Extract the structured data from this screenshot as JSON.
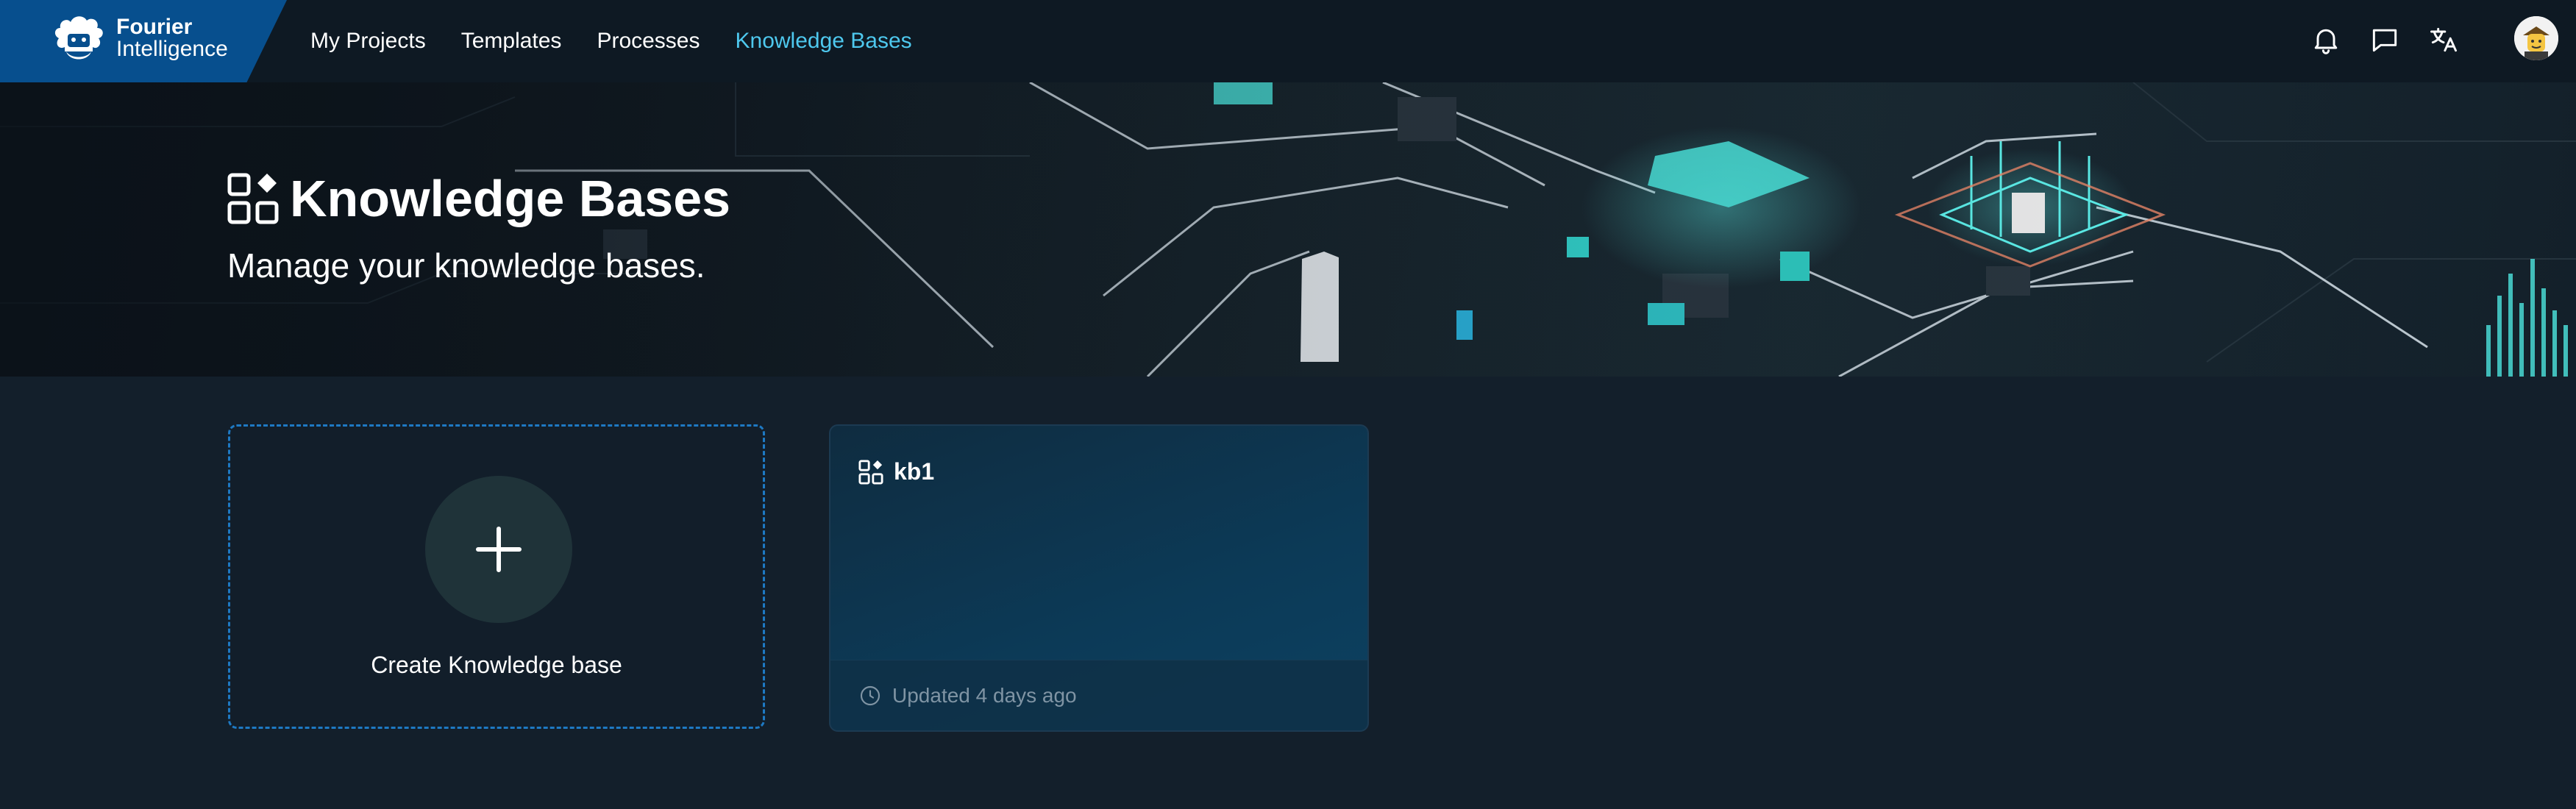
{
  "brand": {
    "name_line1": "Fourier",
    "name_line2": "Intelligence"
  },
  "nav": {
    "links": [
      {
        "label": "My Projects",
        "active": false
      },
      {
        "label": "Templates",
        "active": false
      },
      {
        "label": "Processes",
        "active": false
      },
      {
        "label": "Knowledge Bases",
        "active": true
      }
    ],
    "icons": [
      "bell-icon",
      "message-icon",
      "translate-icon"
    ],
    "accent_color": "#4ec8ee"
  },
  "banner": {
    "title": "Knowledge Bases",
    "subtitle": "Manage your knowledge bases.",
    "icon": "knowledge-base-icon"
  },
  "create_card": {
    "label": "Create Knowledge base",
    "icon": "plus-icon",
    "border_color": "#1e79c3"
  },
  "knowledge_bases": [
    {
      "name": "kb1",
      "updated": "Updated 4 days ago",
      "icon": "knowledge-base-icon"
    }
  ]
}
